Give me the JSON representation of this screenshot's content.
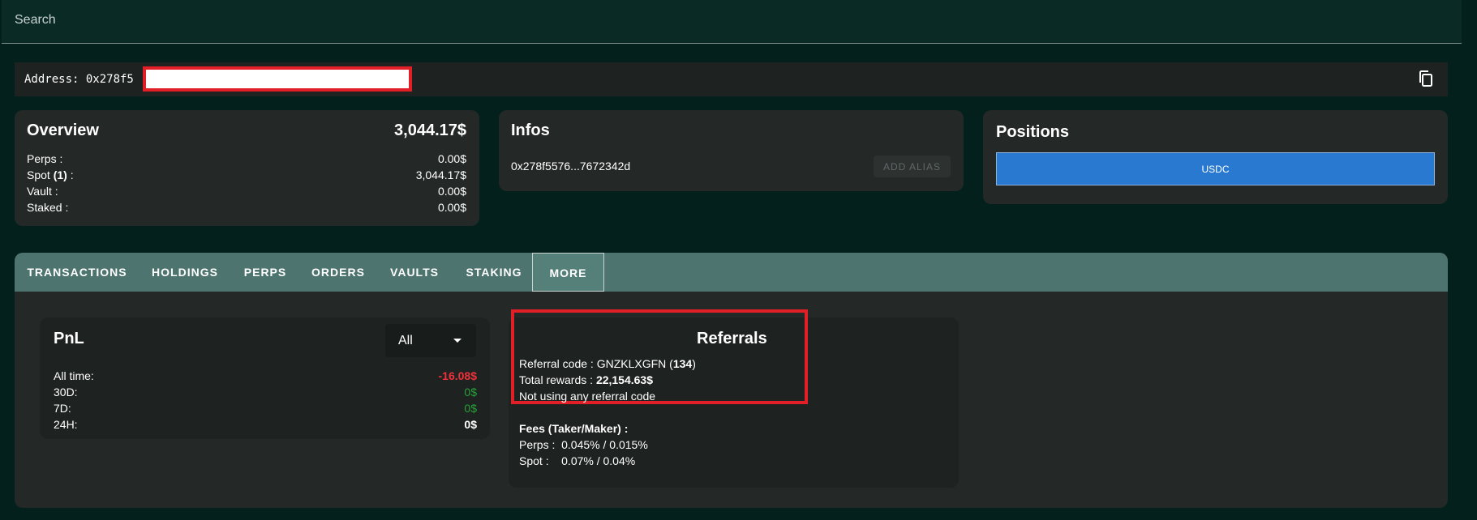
{
  "search": {
    "placeholder": "Search"
  },
  "address": {
    "label": "Address: 0x278f5",
    "copy_icon": "copy-icon"
  },
  "overview": {
    "title": "Overview",
    "total": "3,044.17$",
    "rows": [
      {
        "label": "Perps :",
        "value": "0.00$"
      },
      {
        "label_prefix": "Spot ",
        "label_count": "(1)",
        "label_suffix": " :",
        "value": "3,044.17$"
      },
      {
        "label": "Vault :",
        "value": "0.00$"
      },
      {
        "label": "Staked :",
        "value": "0.00$"
      }
    ]
  },
  "infos": {
    "title": "Infos",
    "address_short": "0x278f5576...7672342d",
    "add_alias_label": "ADD ALIAS"
  },
  "positions": {
    "title": "Positions",
    "asset_button": "USDC"
  },
  "tabs": [
    {
      "label": "TRANSACTIONS"
    },
    {
      "label": "HOLDINGS"
    },
    {
      "label": "PERPS"
    },
    {
      "label": "ORDERS"
    },
    {
      "label": "VAULTS"
    },
    {
      "label": "STAKING"
    },
    {
      "label": "MORE"
    }
  ],
  "active_tab": "MORE",
  "pnl": {
    "title": "PnL",
    "range_selected": "All",
    "rows": [
      {
        "label": "All time:",
        "value": "-16.08$"
      },
      {
        "label": "30D:",
        "value": "0$"
      },
      {
        "label": "7D:",
        "value": "0$"
      },
      {
        "label": "24H:",
        "value": "0$"
      }
    ]
  },
  "referrals": {
    "title": "Referrals",
    "code_label": "Referral code : ",
    "code": "GNZKLXGFN",
    "code_count": "134",
    "rewards_label": "Total rewards : ",
    "rewards_value": "22,154.63$",
    "not_using": "Not using any referral code",
    "fees_title": "Fees (Taker/Maker) :",
    "fees_perps": "Perps :  0.045% / 0.015%",
    "fees_spot": "Spot :    0.07% / 0.04%"
  },
  "colors": {
    "background": "#04201c",
    "card": "#242827",
    "tabs_bar": "#4d746f",
    "negative": "#f0313a",
    "positive": "#27a336",
    "accent_blue": "#2a79d1",
    "highlight_red": "#e21f26"
  }
}
